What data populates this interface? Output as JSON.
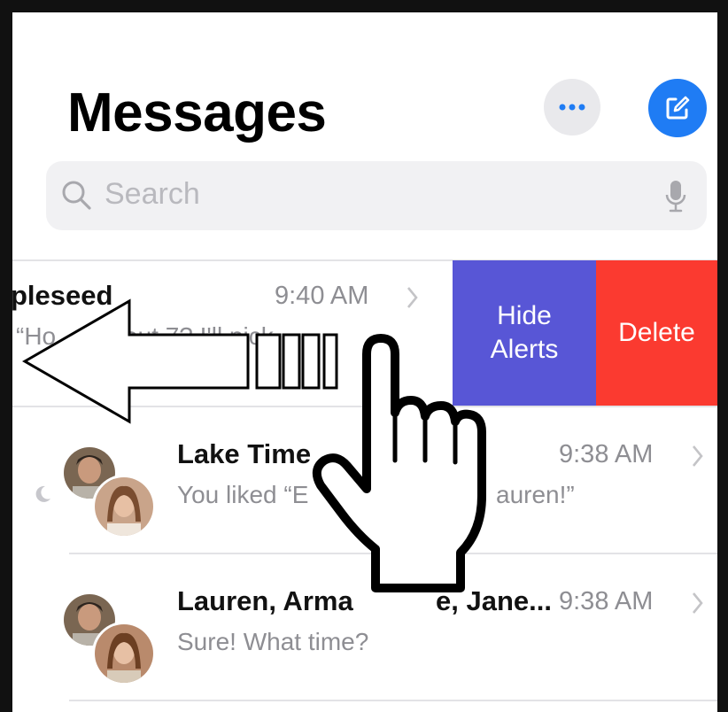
{
  "header": {
    "title": "Messages",
    "more_icon": "ellipsis-icon",
    "compose_icon": "compose-icon",
    "compose_color": "#1f7cf4"
  },
  "search": {
    "placeholder": "Search",
    "search_icon": "search-icon",
    "mic_icon": "microphone-icon"
  },
  "conversations": [
    {
      "name": "pleseed",
      "preview": "“Ho",
      "preview_tail": "out 7? I'll pick",
      "time": "9:40 AM",
      "swiped": true
    },
    {
      "name": "Lake Time",
      "preview": "You liked “E",
      "preview_tail": "auren!”",
      "time": "9:38 AM",
      "muted": true
    },
    {
      "name": "Lauren, Arma",
      "name_tail": "e, Jane...",
      "preview": "Sure! What time?",
      "time": "9:38 AM"
    }
  ],
  "swipe_actions": {
    "hide_alerts_line1": "Hide",
    "hide_alerts_line2": "Alerts",
    "delete": "Delete",
    "hide_color": "#5856d6",
    "delete_color": "#fb3a30"
  },
  "overlay": {
    "arrow_icon": "left-arrow-icon",
    "hand_icon": "pointing-hand-icon"
  }
}
